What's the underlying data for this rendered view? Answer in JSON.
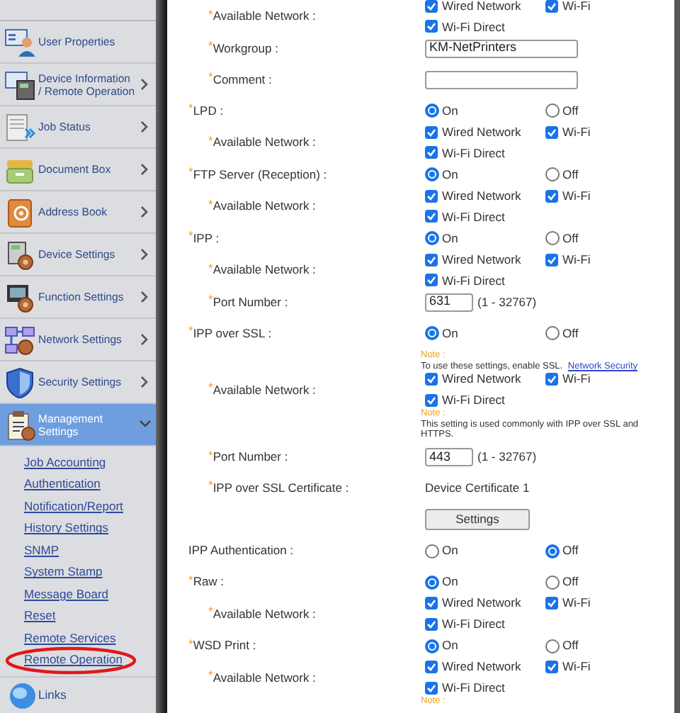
{
  "sidebar": {
    "items": [
      {
        "label": "User Properties"
      },
      {
        "label": "Device Information / Remote Operation",
        "expanded": false
      },
      {
        "label": "Job Status",
        "expanded": false
      },
      {
        "label": "Document Box",
        "expanded": false
      },
      {
        "label": "Address Book",
        "expanded": false
      },
      {
        "label": "Device Settings",
        "expanded": false
      },
      {
        "label": "Function Settings",
        "expanded": false
      },
      {
        "label": "Network Settings",
        "expanded": false
      },
      {
        "label": "Security Settings",
        "expanded": false
      },
      {
        "label": "Management Settings",
        "expanded": true,
        "children": [
          {
            "label": "Job Accounting",
            "circled": false
          },
          {
            "label": "Authentication",
            "circled": false
          },
          {
            "label": "Notification/Report",
            "circled": false
          },
          {
            "label": "History Settings",
            "circled": false
          },
          {
            "label": "SNMP",
            "circled": false
          },
          {
            "label": "System Stamp",
            "circled": false
          },
          {
            "label": "Message Board",
            "circled": false
          },
          {
            "label": "Reset",
            "circled": false
          },
          {
            "label": "Remote Services",
            "circled": false
          },
          {
            "label": "Remote Operation",
            "circled": true
          }
        ]
      }
    ],
    "footer": {
      "label": "Links"
    }
  },
  "settings": [
    {
      "children": [
        {
          "kind": "network",
          "required_mark": "*",
          "label": "Available Network :",
          "options": [
            {
              "label": "Wired Network",
              "checked": true
            },
            {
              "label": "Wi-Fi",
              "checked": true
            },
            {
              "label": "Wi-Fi Direct",
              "checked": true
            }
          ]
        },
        {
          "kind": "text",
          "required_mark": "*",
          "label": "Workgroup :",
          "value": "KM-NetPrinters"
        },
        {
          "kind": "text",
          "required_mark": "*",
          "label": "Comment :"
        }
      ]
    },
    {
      "kind": "radio",
      "required_mark": "*",
      "label": "LPD :",
      "options": [
        {
          "label": "On",
          "selected": true
        },
        {
          "label": "Off",
          "selected": false
        }
      ],
      "children": [
        {
          "kind": "network",
          "required_mark": "*",
          "label": "Available Network :",
          "options": [
            {
              "label": "Wired Network",
              "checked": true
            },
            {
              "label": "Wi-Fi",
              "checked": true
            },
            {
              "label": "Wi-Fi Direct",
              "checked": true
            }
          ]
        }
      ]
    },
    {
      "kind": "radio",
      "required_mark": "*",
      "label": "FTP Server (Reception) :",
      "options": [
        {
          "label": "On",
          "selected": true
        },
        {
          "label": "Off",
          "selected": false
        }
      ],
      "children": [
        {
          "kind": "network",
          "required_mark": "*",
          "label": "Available Network :",
          "options": [
            {
              "label": "Wired Network",
              "checked": true
            },
            {
              "label": "Wi-Fi",
              "checked": true
            },
            {
              "label": "Wi-Fi Direct",
              "checked": true
            }
          ]
        }
      ]
    },
    {
      "kind": "radio",
      "required_mark": "*",
      "label": "IPP :",
      "options": [
        {
          "label": "On",
          "selected": true
        },
        {
          "label": "Off",
          "selected": false
        }
      ],
      "children": [
        {
          "kind": "network",
          "required_mark": "*",
          "label": "Available Network :",
          "options": [
            {
              "label": "Wired Network",
              "checked": true
            },
            {
              "label": "Wi-Fi",
              "checked": true
            },
            {
              "label": "Wi-Fi Direct",
              "checked": true
            }
          ]
        },
        {
          "kind": "port",
          "required_mark": "*",
          "label": "Port Number :",
          "value": "631",
          "range": "(1 - 32767)"
        }
      ]
    },
    {
      "kind": "radio",
      "required_mark": "*",
      "label": "IPP over SSL :",
      "options": [
        {
          "label": "On",
          "selected": true
        },
        {
          "label": "Off",
          "selected": false
        }
      ],
      "children": [
        {
          "kind": "note",
          "heading": "Note :",
          "text": "To use these settings, enable SSL.",
          "link": "Network Security"
        },
        {
          "kind": "network",
          "required_mark": "*",
          "label": "Available Network :",
          "options": [
            {
              "label": "Wired Network",
              "checked": true
            },
            {
              "label": "Wi-Fi",
              "checked": true
            },
            {
              "label": "Wi-Fi Direct",
              "checked": true
            }
          ]
        },
        {
          "kind": "note",
          "heading": "Note :",
          "text": "This setting is used commonly with IPP over SSL and HTTPS."
        },
        {
          "kind": "port",
          "required_mark": "*",
          "label": "Port Number :",
          "value": "443",
          "range": "(1 - 32767)"
        },
        {
          "kind": "value",
          "required_mark": "*",
          "label": "IPP over SSL Certificate :",
          "value": "Device Certificate 1"
        },
        {
          "kind": "button",
          "label": "Settings"
        }
      ]
    },
    {
      "kind": "radio",
      "label": "IPP Authentication :",
      "options": [
        {
          "label": "On",
          "selected": false
        },
        {
          "label": "Off",
          "selected": true
        }
      ]
    },
    {
      "kind": "radio",
      "required_mark": "*",
      "label": "Raw :",
      "options": [
        {
          "label": "On",
          "selected": true
        },
        {
          "label": "Off",
          "selected": false
        }
      ],
      "children": [
        {
          "kind": "network",
          "required_mark": "*",
          "label": "Available Network :",
          "options": [
            {
              "label": "Wired Network",
              "checked": true
            },
            {
              "label": "Wi-Fi",
              "checked": true
            },
            {
              "label": "Wi-Fi Direct",
              "checked": true
            }
          ]
        }
      ]
    },
    {
      "kind": "radio",
      "required_mark": "*",
      "label": "WSD Print :",
      "options": [
        {
          "label": "On",
          "selected": true
        },
        {
          "label": "Off",
          "selected": false
        }
      ],
      "children": [
        {
          "kind": "network",
          "required_mark": "*",
          "label": "Available Network :",
          "options": [
            {
              "label": "Wired Network",
              "checked": true
            },
            {
              "label": "Wi-Fi",
              "checked": true
            },
            {
              "label": "Wi-Fi Direct",
              "checked": true
            }
          ]
        },
        {
          "kind": "note",
          "heading": "Note :"
        }
      ]
    }
  ]
}
